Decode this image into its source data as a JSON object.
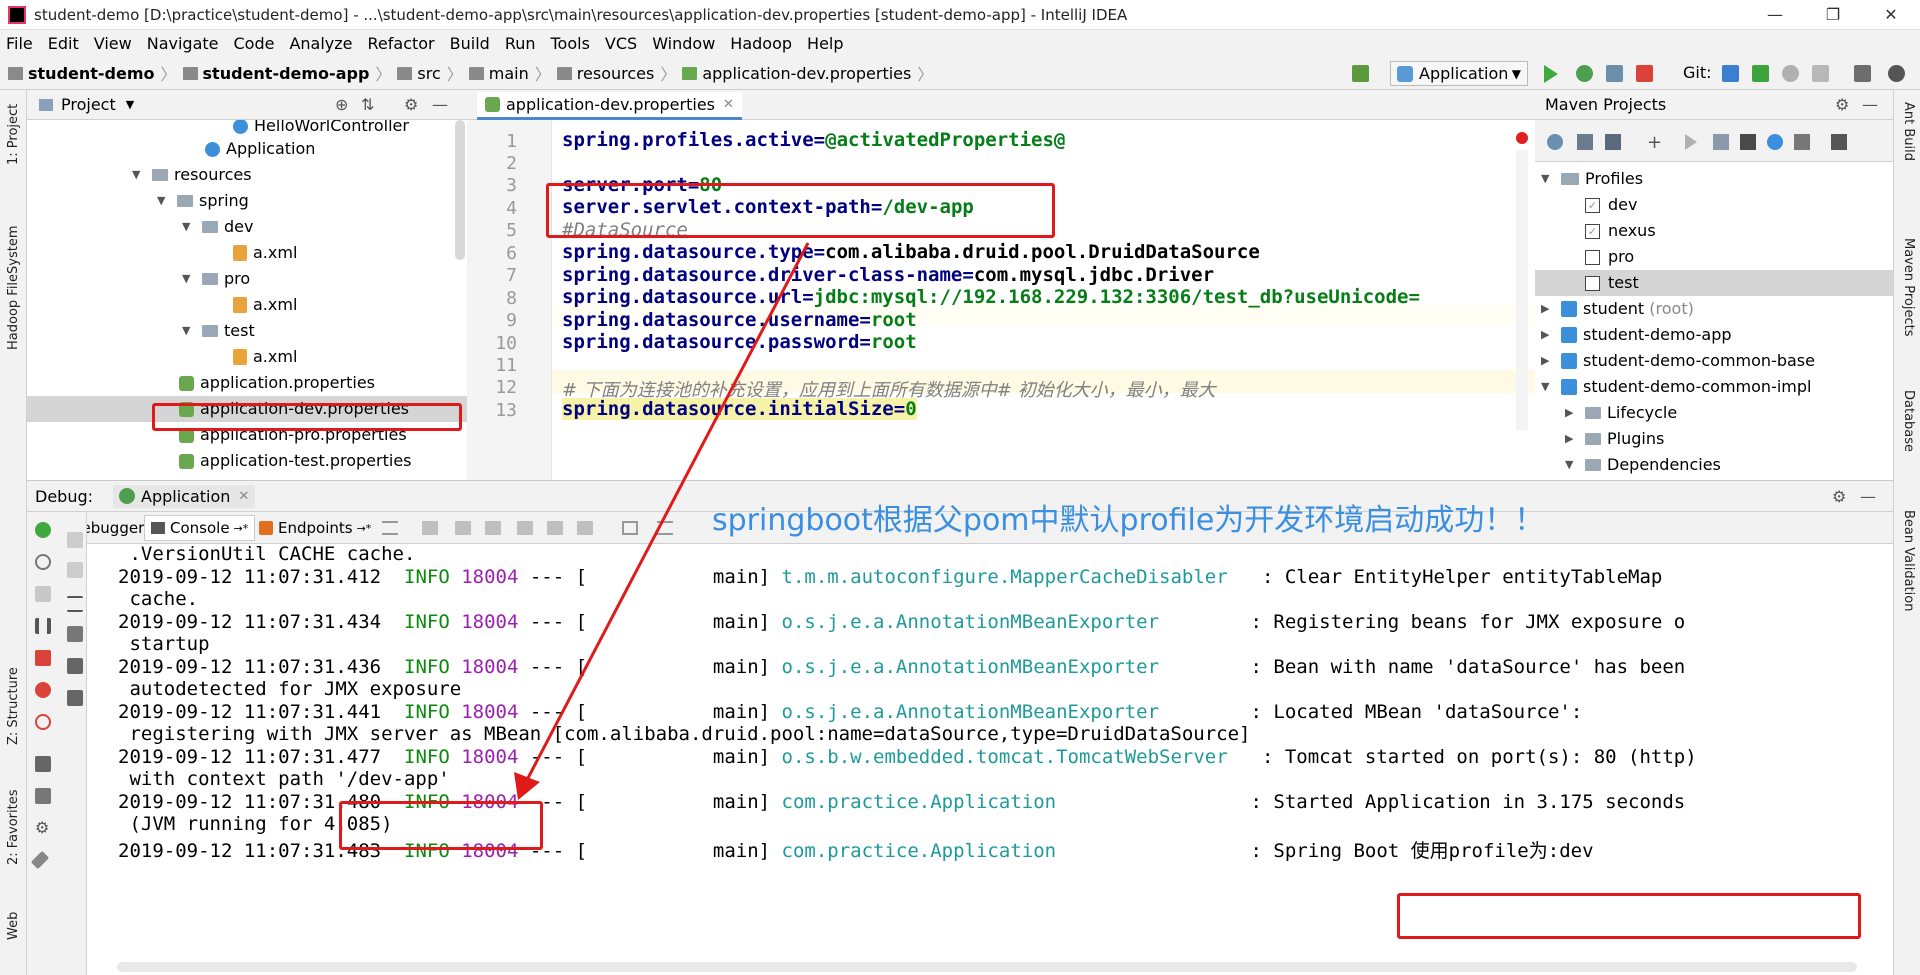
{
  "window": {
    "title": "student-demo [D:\\practice\\student-demo] - ...\\student-demo-app\\src\\main\\resources\\application-dev.properties [student-demo-app] - IntelliJ IDEA",
    "minimize": "—",
    "maximize": "❐",
    "close": "✕"
  },
  "menu": [
    "File",
    "Edit",
    "View",
    "Navigate",
    "Code",
    "Analyze",
    "Refactor",
    "Build",
    "Run",
    "Tools",
    "VCS",
    "Window",
    "Hadoop",
    "Help"
  ],
  "breadcrumbs": [
    "student-demo",
    "student-demo-app",
    "src",
    "main",
    "resources",
    "application-dev.properties"
  ],
  "toolbar": {
    "run_config": "Application",
    "git_label": "Git:"
  },
  "project_panel": {
    "title": "Project",
    "items": [
      {
        "label": "HelloWorlController",
        "icon": "class-icon"
      },
      {
        "label": "Application",
        "icon": "class-icon"
      },
      {
        "label": "resources",
        "icon": "folder-icon"
      },
      {
        "label": "spring",
        "icon": "folder-icon"
      },
      {
        "label": "dev",
        "icon": "folder-icon"
      },
      {
        "label": "a.xml",
        "icon": "xml-icon"
      },
      {
        "label": "pro",
        "icon": "folder-icon"
      },
      {
        "label": "a.xml",
        "icon": "xml-icon"
      },
      {
        "label": "test",
        "icon": "folder-icon"
      },
      {
        "label": "a.xml",
        "icon": "xml-icon"
      },
      {
        "label": "application.properties",
        "icon": "properties-icon"
      },
      {
        "label": "application-dev.properties",
        "icon": "properties-icon"
      },
      {
        "label": "application-pro.properties",
        "icon": "properties-icon"
      },
      {
        "label": "application-test.properties",
        "icon": "properties-icon"
      }
    ]
  },
  "editor": {
    "tab": "application-dev.properties",
    "lines": [
      {
        "n": "1",
        "k": "spring.profiles.active",
        "v": "@activatedProperties@"
      },
      {
        "n": "2",
        "k": "",
        "v": ""
      },
      {
        "n": "3",
        "k": "server.port",
        "v": "80"
      },
      {
        "n": "4",
        "k": "server.servlet.context-path",
        "v": "/dev-app"
      },
      {
        "n": "5",
        "c": "#DataSource"
      },
      {
        "n": "6",
        "k": "spring.datasource.type",
        "v": "com.alibaba.druid.pool.DruidDataSource"
      },
      {
        "n": "7",
        "k": "spring.datasource.driver-class-name",
        "v": "com.mysql.jdbc.Driver"
      },
      {
        "n": "8",
        "k": "spring.datasource.url",
        "v": "jdbc:mysql://192.168.229.132:3306/test_db?useUnicode="
      },
      {
        "n": "9",
        "k": "spring.datasource.username",
        "v": "root"
      },
      {
        "n": "10",
        "k": "spring.datasource.password",
        "v": "root"
      },
      {
        "n": "11",
        "k": "",
        "v": ""
      },
      {
        "n": "12",
        "c": "# 下面为连接池的补充设置，应用到上面所有数据源中# 初始化大小，最小，最大"
      },
      {
        "n": "13",
        "k": "spring.datasource.initialSize",
        "v": "0"
      }
    ]
  },
  "maven": {
    "title": "Maven Projects",
    "profiles_label": "Profiles",
    "profiles": [
      {
        "label": "dev",
        "checked": true
      },
      {
        "label": "nexus",
        "checked": true
      },
      {
        "label": "pro",
        "checked": false
      },
      {
        "label": "test",
        "checked": false
      }
    ],
    "projects": [
      "student",
      "student-demo-app",
      "student-demo-common-base",
      "student-demo-common-impl"
    ],
    "root_suffix": "(root)",
    "sub": [
      "Lifecycle",
      "Plugins",
      "Dependencies"
    ]
  },
  "debug": {
    "label": "Debug:",
    "config": "Application",
    "tabs": [
      "Debugger",
      "Console",
      "Endpoints"
    ],
    "annotation": "springboot根据父pom中默认profile为开发环境启动成功！！",
    "console": [
      {
        "cont": " .VersionUtil CACHE cache."
      },
      {
        "ts": "2019-09-12 11:07:31.412",
        "lvl": "INFO",
        "pid": "18004",
        "mid": " --- [           main] ",
        "logger": "t.m.m.autoconfigure.MapperCacheDisabler  ",
        "msg": " : Clear EntityHelper entityTableMap"
      },
      {
        "cont": " cache."
      },
      {
        "ts": "2019-09-12 11:07:31.434",
        "lvl": "INFO",
        "pid": "18004",
        "mid": " --- [           main] ",
        "logger": "o.s.j.e.a.AnnotationMBeanExporter       ",
        "msg": " : Registering beans for JMX exposure o"
      },
      {
        "cont": " startup"
      },
      {
        "ts": "2019-09-12 11:07:31.436",
        "lvl": "INFO",
        "pid": "18004",
        "mid": " --- [           main] ",
        "logger": "o.s.j.e.a.AnnotationMBeanExporter       ",
        "msg": " : Bean with name 'dataSource' has been"
      },
      {
        "cont": " autodetected for JMX exposure"
      },
      {
        "ts": "2019-09-12 11:07:31.441",
        "lvl": "INFO",
        "pid": "18004",
        "mid": " --- [           main] ",
        "logger": "o.s.j.e.a.AnnotationMBeanExporter       ",
        "msg": " : Located MBean 'dataSource':"
      },
      {
        "cont": " registering with JMX server as MBean [com.alibaba.druid.pool:name=dataSource,type=DruidDataSource]"
      },
      {
        "ts": "2019-09-12 11:07:31.477",
        "lvl": "INFO",
        "pid": "18004",
        "mid": " --- [           main] ",
        "logger": "o.s.b.w.embedded.tomcat.TomcatWebServer  ",
        "msg": " : Tomcat started on port(s): 80 (http)"
      },
      {
        "cont": " with context path '/dev-app'"
      },
      {
        "ts": "2019-09-12 11:07:31.480",
        "lvl": "INFO",
        "pid": "18004",
        "mid": " --- [           main] ",
        "logger": "com.practice.Application                ",
        "msg": " : Started Application in 3.175 seconds"
      },
      {
        "cont": " (JVM running for 4.085)"
      },
      {
        "ts": "2019-09-12 11:07:31.483",
        "lvl": "INFO",
        "pid": "18004",
        "mid": " --- [           main] ",
        "logger": "com.practice.Application                ",
        "msg": " : Spring Boot 使用profile为:dev"
      }
    ]
  },
  "side_tabs": {
    "left": [
      "1: Project",
      "Hadoop FileSystem",
      "Z: Structure",
      "2: Favorites",
      "Web"
    ],
    "right": [
      "Ant Build",
      "Maven Projects",
      "Database",
      "Bean Validation"
    ]
  },
  "colors": {
    "accent": "#4a88c7",
    "annotation": "#3b8fe0",
    "highlight_box": "#e01a1a"
  }
}
